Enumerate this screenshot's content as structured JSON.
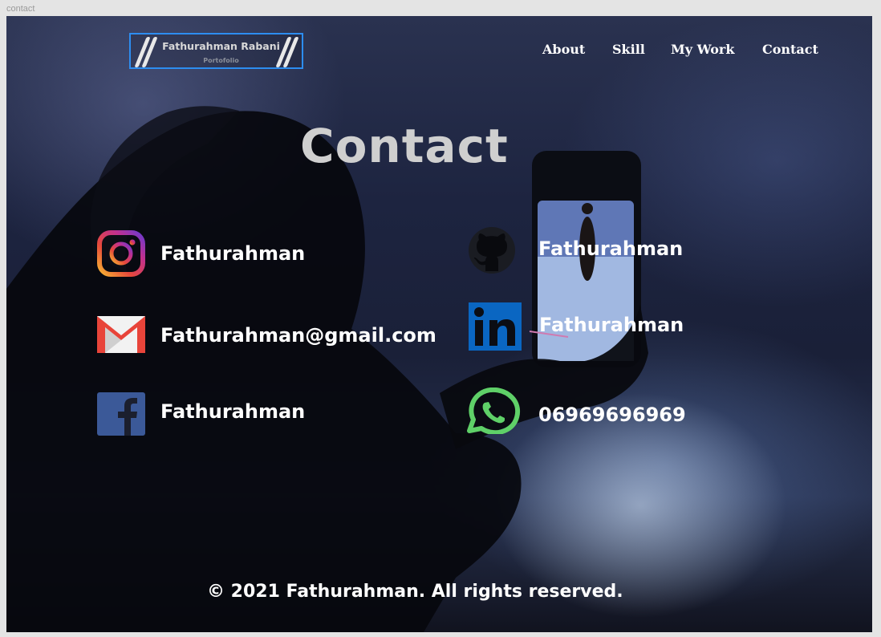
{
  "frame": {
    "label": "contact"
  },
  "logo": {
    "title": "Fathurahman Rabani",
    "subtitle": "Portofolio"
  },
  "nav": {
    "items": [
      "About",
      "Skill",
      "My Work",
      "Contact"
    ]
  },
  "page": {
    "title": "Contact"
  },
  "contacts": {
    "instagram": "Fathurahman",
    "email": "Fathurahman@gmail.com",
    "facebook": "Fathurahman",
    "github": "Fathurahman",
    "linkedin": "Fathurahman",
    "whatsapp": "06969696969"
  },
  "icons": [
    "instagram-icon",
    "gmail-icon",
    "facebook-icon",
    "github-icon",
    "linkedin-icon",
    "whatsapp-icon"
  ],
  "colors": {
    "accent_border": "#2d8df0",
    "title": "#cfcfcf",
    "text": "#ffffff",
    "linkedin": "#0a66c2",
    "whatsapp": "#5fd068",
    "facebook": "#3b5998"
  },
  "footer": {
    "text": "© 2021 Fathurahman. All rights reserved."
  }
}
